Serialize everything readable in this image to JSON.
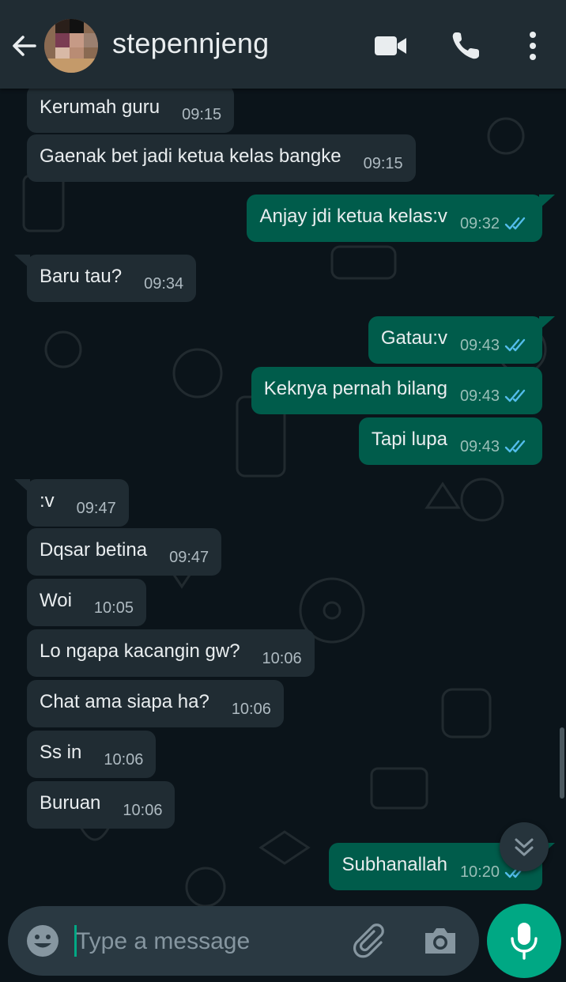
{
  "header": {
    "contact_name": "stepennjeng",
    "icons": [
      "back-arrow-icon",
      "avatar",
      "video-call-icon",
      "phone-icon",
      "more-vert-icon"
    ]
  },
  "messages": [
    {
      "dir": "in",
      "text": "Kerumah guru",
      "time": "09:15"
    },
    {
      "dir": "in",
      "text": "Gaenak bet jadi ketua kelas bangke",
      "time": "09:15"
    },
    {
      "dir": "out",
      "text": "Anjay jdi ketua kelas:v",
      "time": "09:32"
    },
    {
      "dir": "in",
      "text": "Baru tau?",
      "time": "09:34"
    },
    {
      "dir": "out",
      "text": "Gatau:v",
      "time": "09:43"
    },
    {
      "dir": "out",
      "text": "Keknya pernah bilang",
      "time": "09:43"
    },
    {
      "dir": "out",
      "text": "Tapi lupa",
      "time": "09:43"
    },
    {
      "dir": "in",
      "text": ":v",
      "time": "09:47"
    },
    {
      "dir": "in",
      "text": "Dqsar betina",
      "time": "09:47"
    },
    {
      "dir": "in",
      "text": "Woi",
      "time": "10:05"
    },
    {
      "dir": "in",
      "text": "Lo ngapa kacangin gw?",
      "time": "10:06"
    },
    {
      "dir": "in",
      "text": "Chat ama siapa ha?",
      "time": "10:06"
    },
    {
      "dir": "in",
      "text": "Ss in",
      "time": "10:06"
    },
    {
      "dir": "in",
      "text": "Buruan",
      "time": "10:06"
    },
    {
      "dir": "out",
      "text": "Subhanallah",
      "time": "10:20"
    }
  ],
  "input": {
    "placeholder": "Type a message"
  },
  "colors": {
    "header_bg": "#202c33",
    "chat_bg": "#0b141a",
    "incoming_bubble": "#202c33",
    "outgoing_bubble": "#005c4b",
    "read_ticks": "#53bdeb",
    "accent": "#00a884"
  }
}
